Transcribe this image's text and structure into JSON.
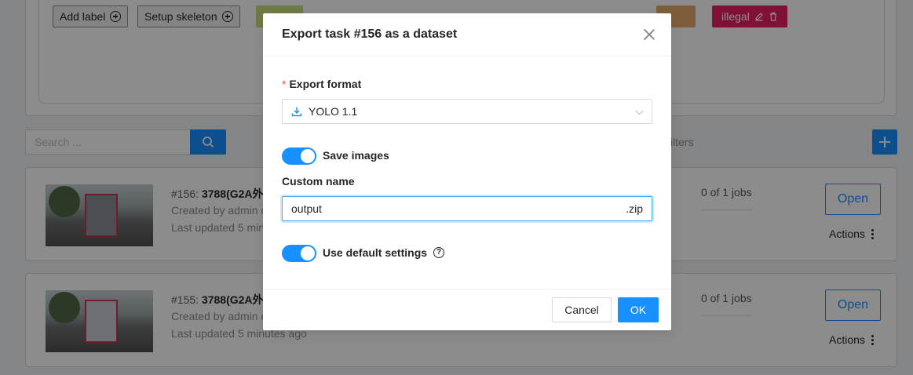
{
  "background": {
    "labels": {
      "add_label": "Add label",
      "setup_skeleton": "Setup skeleton",
      "tags": [
        {
          "name": "illegal",
          "color": "#c2185b"
        }
      ]
    },
    "search": {
      "placeholder": "Search ..."
    },
    "filters_label": "filters",
    "tasks": [
      {
        "id": "#156:",
        "name": "3788(G2A外",
        "created": "Created by admin o",
        "updated": "Last updated 5 min",
        "jobs": "0 of 1 jobs",
        "open_label": "Open",
        "actions_label": "Actions"
      },
      {
        "id": "#155:",
        "name": "3788(G2A外",
        "created": "Created by admin o",
        "updated": "Last updated 5 minutes ago",
        "jobs": "0 of 1 jobs",
        "open_label": "Open",
        "actions_label": "Actions"
      }
    ]
  },
  "modal": {
    "title": "Export task #156 as a dataset",
    "export_format_label": "Export format",
    "export_format_value": "YOLO 1.1",
    "save_images_label": "Save images",
    "save_images_on": true,
    "custom_name_label": "Custom name",
    "custom_name_value": "output",
    "custom_name_suffix": ".zip",
    "use_default_label": "Use default settings",
    "use_default_on": true,
    "cancel_label": "Cancel",
    "ok_label": "OK"
  },
  "colors": {
    "primary": "#1890ff",
    "mask": "rgba(0,0,0,0.45)"
  }
}
